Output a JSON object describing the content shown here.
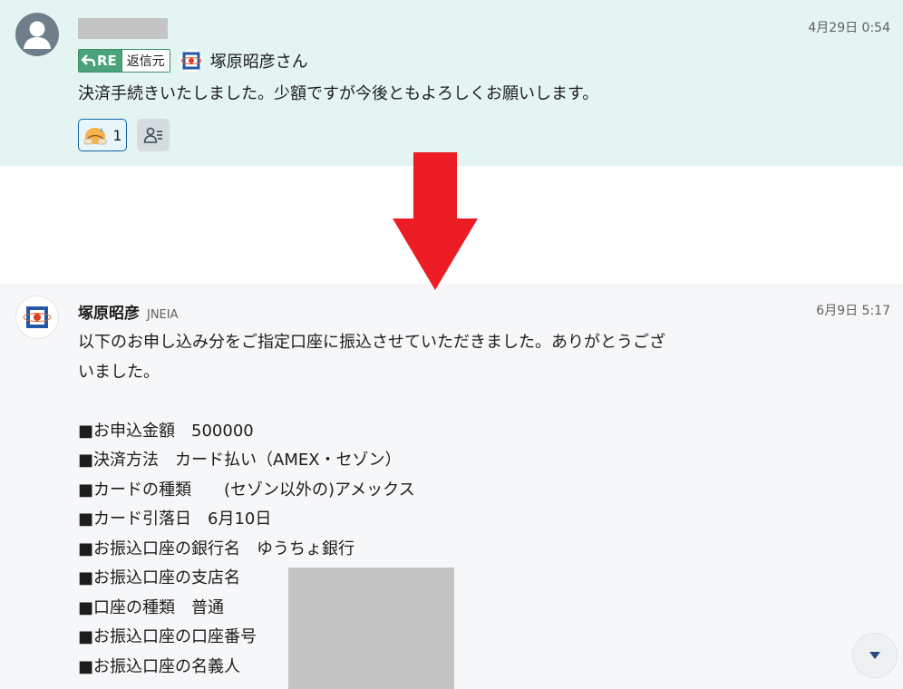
{
  "message1": {
    "timestamp": "4月29日 0:54",
    "reply_badge": {
      "tag": "RE",
      "origin_label": "返信元",
      "to_name": "塚原昭彦さん"
    },
    "text": "決済手続きいたしました。少額ですが今後ともよろしくお願いします。",
    "reactions": [
      {
        "emoji_icon": "sweat-smile-bow-emoji-icon",
        "count": "1"
      }
    ]
  },
  "message2": {
    "sender_name": "塚原昭彦",
    "sender_org": "JNEIA",
    "timestamp": "6月9日 5:17",
    "lines": [
      "以下のお申し込み分をご指定口座に振込させていただきました。ありがとうござ",
      "いました。",
      "",
      "■お申込金額　500000",
      "■決済方法　カード払い（AMEX・セゾン）",
      "■カードの種類　　(セゾン以外の)アメックス",
      "■カード引落日　6月10日",
      "■お振込口座の銀行名　ゆうちょ銀行",
      "■お振込口座の支店名",
      "■口座の種類　普通",
      "■お振込口座の口座番号",
      "■お振込口座の名義人"
    ]
  },
  "colors": {
    "highlight_bg": "#e3f4f2",
    "message_bg": "#f6f7f9",
    "re_green": "#4aa37a",
    "arrow_red": "#ec1c24",
    "redaction_gray": "#c4c4c4"
  }
}
